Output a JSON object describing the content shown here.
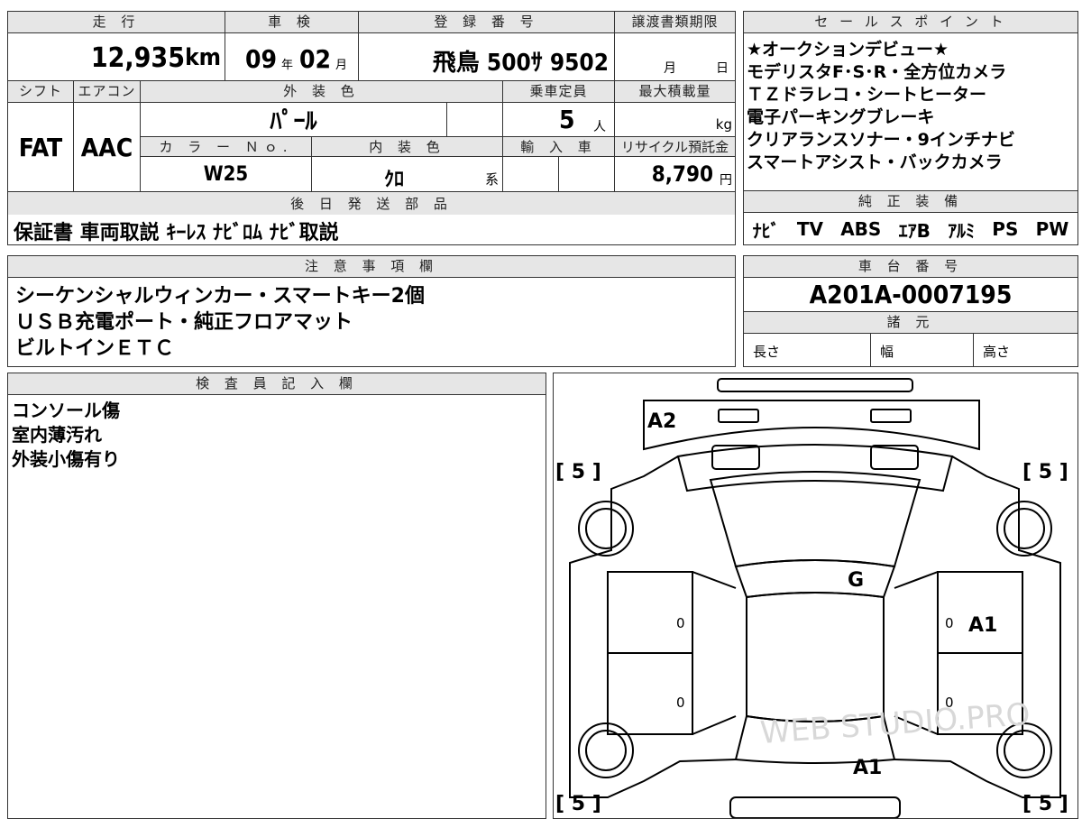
{
  "vehicle": {
    "mileage_label": "走 行",
    "mileage_value": "12,935",
    "mileage_unit": "km",
    "inspection_label": "車 検",
    "inspection_year": "09",
    "inspection_year_unit": "年",
    "inspection_month": "02",
    "inspection_month_unit": "月",
    "registration_label": "登 録 番 号",
    "registration_value": "飛鳥 500ｻ 9502",
    "transfer_doc_label": "譲渡書類期限",
    "transfer_month_unit": "月",
    "transfer_day_unit": "日",
    "shift_label": "シフト",
    "shift_value": "FAT",
    "aircon_label": "エアコン",
    "aircon_value": "AAC",
    "exterior_color_label": "外 装 色",
    "exterior_color_value": "ﾊﾟｰﾙ",
    "capacity_label": "乗車定員",
    "capacity_value": "5",
    "capacity_unit": "人",
    "max_load_label": "最大積載量",
    "max_load_unit": "kg",
    "color_no_label": "カ ラ ー Ｎｏ.",
    "color_no_value": "W25",
    "interior_color_label": "内 装 色",
    "interior_color_value": "ｸﾛ",
    "interior_color_suffix": "系",
    "import_label": "輸 入 車",
    "recycle_label": "リサイクル預託金",
    "recycle_value": "8,790",
    "recycle_unit": "円"
  },
  "later_parts": {
    "label": "後 日 発 送 部 品",
    "value": "保証書 車両取説 ｷｰﾚｽ ﾅﾋﾞﾛﾑ ﾅﾋﾞ取説"
  },
  "sales_points": {
    "label": "セ ー ル ス ポ イ ン ト",
    "lines": [
      "★オークションデビュー★",
      "モデリスタF･S･R・全方位カメラ",
      "ＴＺドラレコ・シートヒーター",
      "電子パーキングブレーキ",
      "クリアランスソナー・9インチナビ",
      "スマートアシスト・バックカメラ"
    ]
  },
  "equipment": {
    "label": "純 正 装 備",
    "items": [
      "ﾅﾋﾞ",
      "TV",
      "ABS",
      "ｴｱB",
      "ｱﾙﾐ",
      "PS",
      "PW"
    ]
  },
  "notes": {
    "label": "注 意 事 項 欄",
    "lines": [
      "シーケンシャルウィンカー・スマートキー2個",
      "ＵＳＢ充電ポート・純正フロアマット",
      "ビルトインＥＴＣ"
    ]
  },
  "chassis": {
    "label": "車 台 番 号",
    "value": "A201A-0007195"
  },
  "specs": {
    "label": "諸 元",
    "length_label": "長さ",
    "width_label": "幅",
    "height_label": "高さ"
  },
  "inspector": {
    "label": "検 査 員 記 入 欄",
    "lines": [
      "コンソール傷",
      "室内薄汚れ",
      "外装小傷有り"
    ]
  },
  "diagram": {
    "front_left_tire": "5",
    "front_right_tire": "5",
    "rear_left_tire": "5",
    "rear_right_tire": "5",
    "mark_front_bumper": "A2",
    "mark_windshield": "G",
    "mark_right_door": "A1",
    "mark_rear": "A1",
    "door_zero": "0",
    "watermark": "WEB STUDIO.PRO"
  }
}
